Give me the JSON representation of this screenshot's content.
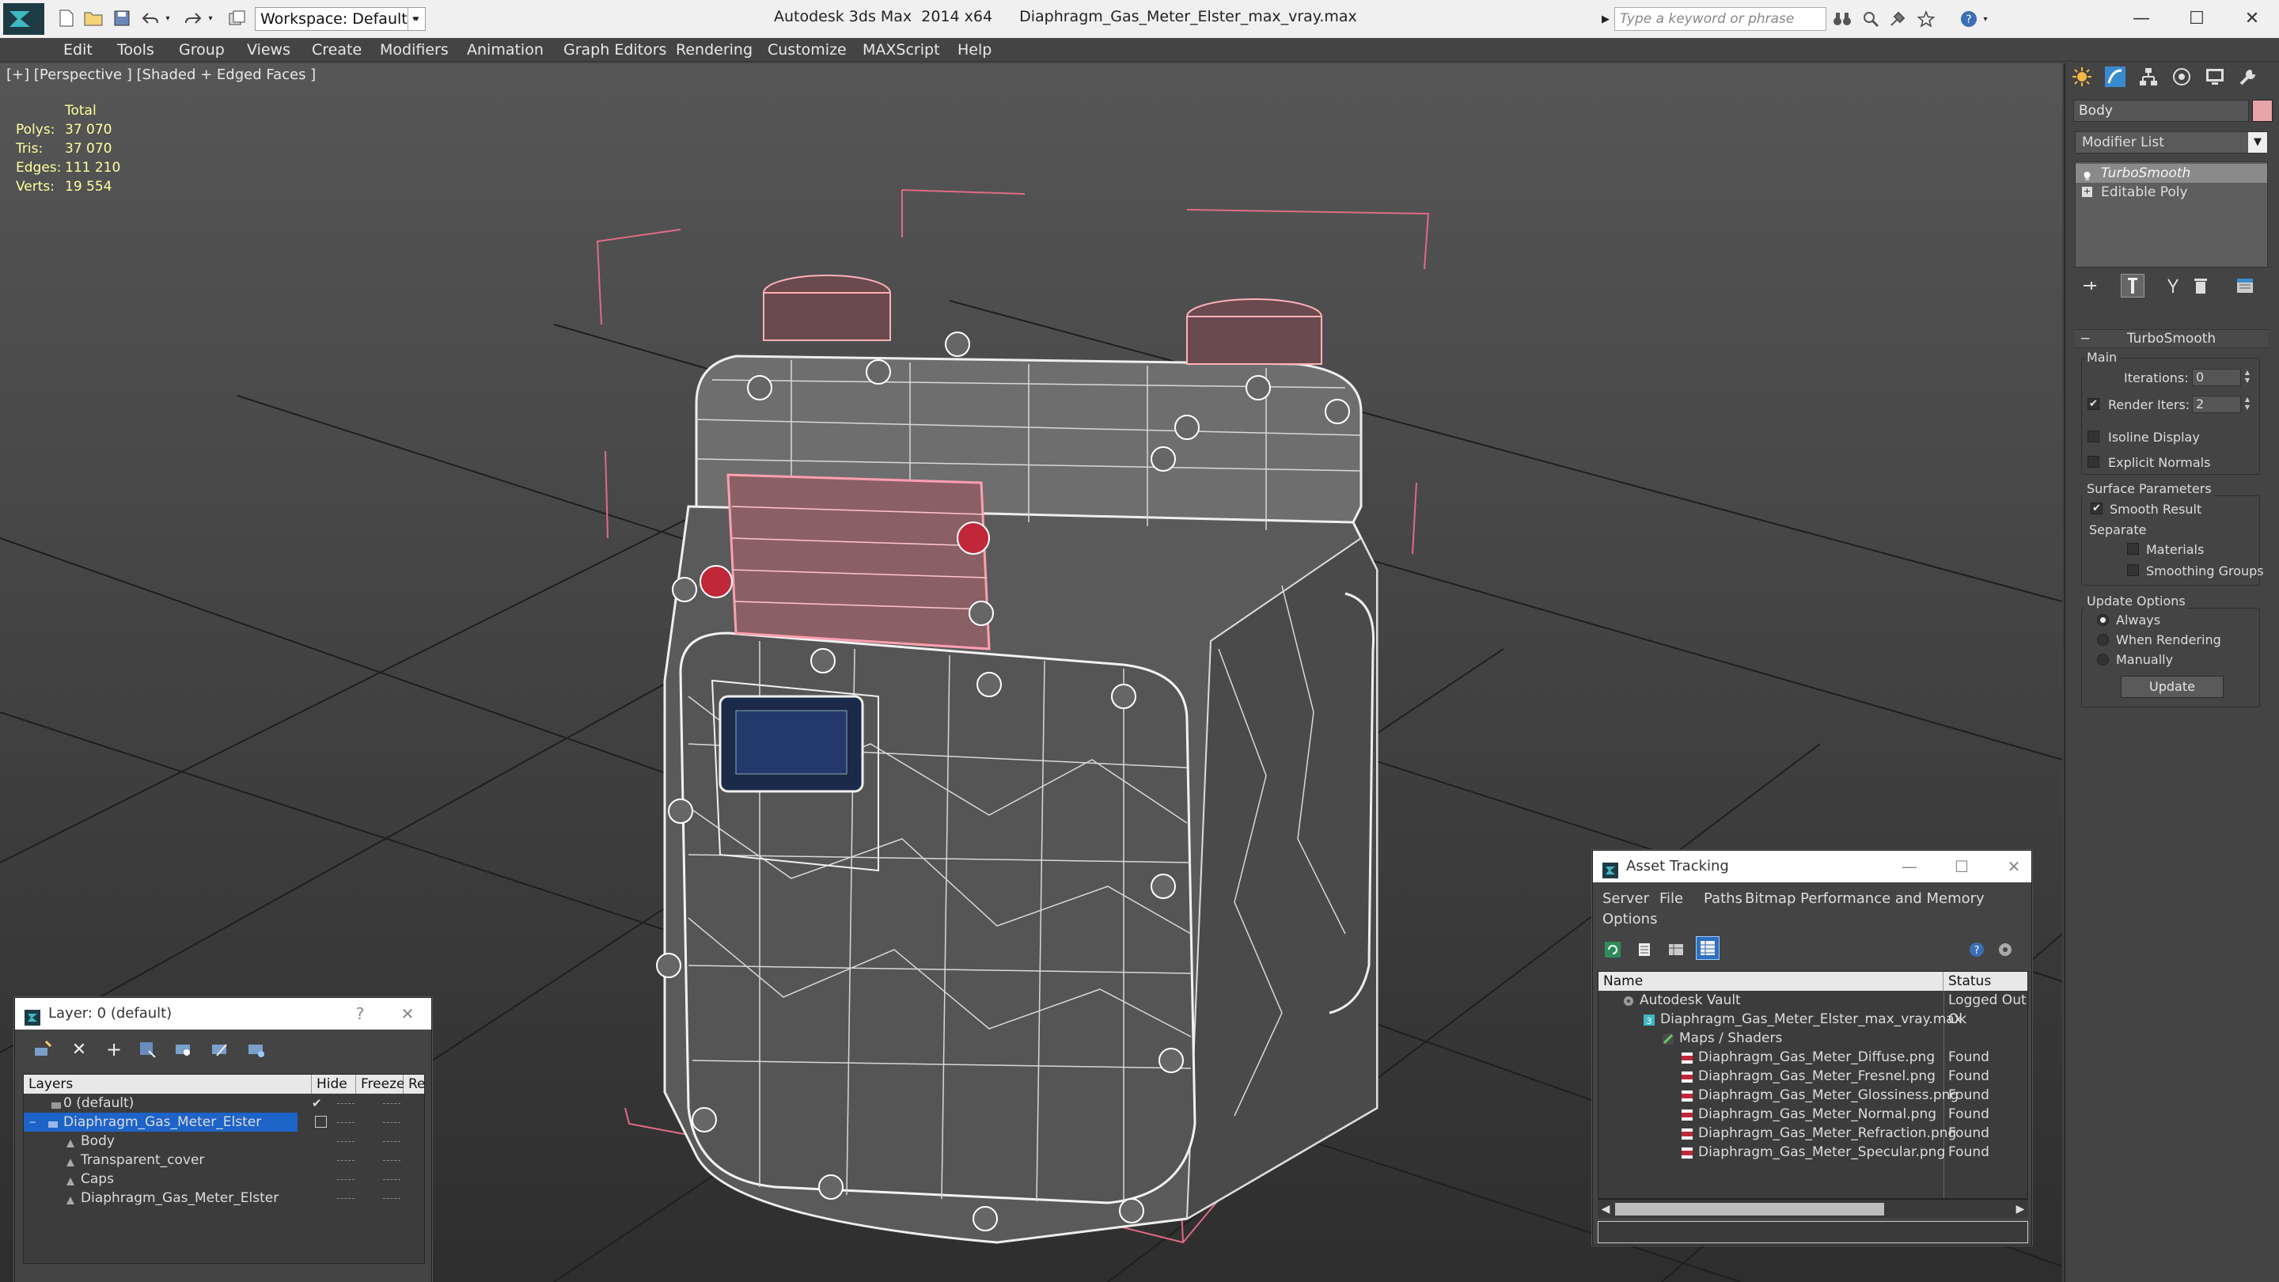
{
  "titlebar": {
    "workspace": "Workspace: Default",
    "app_title": "Autodesk 3ds Max  2014 x64",
    "file_title": "Diaphragm_Gas_Meter_Elster_max_vray.max",
    "search_placeholder": "Type a keyword or phrase"
  },
  "menu": [
    "Edit",
    "Tools",
    "Group",
    "Views",
    "Create",
    "Modifiers",
    "Animation",
    "Graph Editors",
    "Rendering",
    "Customize",
    "MAXScript",
    "Help"
  ],
  "viewport": {
    "label": "[+] [Perspective ] [Shaded + Edged Faces ]",
    "stats": {
      "header": "Total",
      "rows": [
        {
          "key": "Polys:",
          "value": "37 070"
        },
        {
          "key": "Tris:",
          "value": "37 070"
        },
        {
          "key": "Edges:",
          "value": "111 210"
        },
        {
          "key": "Verts:",
          "value": "19 554"
        }
      ]
    }
  },
  "command_panel": {
    "object_name": "Body",
    "object_color": "#e8a4a8",
    "modifier_list": "Modifier List",
    "stack": [
      "TurboSmooth",
      "Editable Poly"
    ],
    "rollout_title": "TurboSmooth",
    "main_group": "Main",
    "iterations_label": "Iterations:",
    "iterations_value": "0",
    "render_iters_label": "Render Iters:",
    "render_iters_value": "2",
    "render_iters_checked": true,
    "isoline_label": "Isoline Display",
    "explicit_normals_label": "Explicit Normals",
    "surface_group": "Surface Parameters",
    "smooth_result_label": "Smooth Result",
    "separate_label": "Separate",
    "materials_label": "Materials",
    "smoothing_groups_label": "Smoothing Groups",
    "update_group": "Update Options",
    "update_always": "Always",
    "update_rendering": "When Rendering",
    "update_manually": "Manually",
    "update_button": "Update"
  },
  "layer_window": {
    "title": "Layer: 0 (default)",
    "help": "?",
    "columns": [
      "Layers",
      "Hide",
      "Freeze",
      "Re"
    ],
    "rows": [
      {
        "name": "0 (default)",
        "level": 1,
        "selected": false
      },
      {
        "name": "Diaphragm_Gas_Meter_Elster",
        "level": 1,
        "selected": true
      },
      {
        "name": "Body",
        "level": 2,
        "selected": false
      },
      {
        "name": "Transparent_cover",
        "level": 2,
        "selected": false
      },
      {
        "name": "Caps",
        "level": 2,
        "selected": false
      },
      {
        "name": "Diaphragm_Gas_Meter_Elster",
        "level": 2,
        "selected": false
      }
    ]
  },
  "asset_window": {
    "title": "Asset Tracking",
    "menu": [
      "Server",
      "File",
      "Paths",
      "Bitmap Performance and Memory",
      "Options"
    ],
    "columns": [
      "Name",
      "Status"
    ],
    "rows": [
      {
        "name": "Autodesk Vault",
        "status": "Logged Out",
        "level": 0
      },
      {
        "name": "Diaphragm_Gas_Meter_Elster_max_vray.max",
        "status": "Ok",
        "level": 1
      },
      {
        "name": "Maps / Shaders",
        "status": "",
        "level": 2
      },
      {
        "name": "Diaphragm_Gas_Meter_Diffuse.png",
        "status": "Found",
        "level": 3
      },
      {
        "name": "Diaphragm_Gas_Meter_Fresnel.png",
        "status": "Found",
        "level": 3
      },
      {
        "name": "Diaphragm_Gas_Meter_Glossiness.png",
        "status": "Found",
        "level": 3
      },
      {
        "name": "Diaphragm_Gas_Meter_Normal.png",
        "status": "Found",
        "level": 3
      },
      {
        "name": "Diaphragm_Gas_Meter_Refraction.png",
        "status": "Found",
        "level": 3
      },
      {
        "name": "Diaphragm_Gas_Meter_Specular.png",
        "status": "Found",
        "level": 3
      }
    ]
  }
}
